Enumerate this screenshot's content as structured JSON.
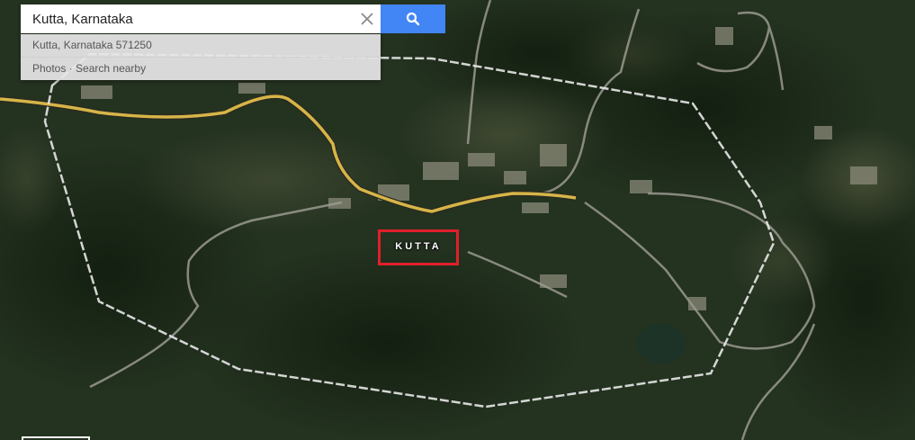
{
  "search": {
    "value": "Kutta, Karnataka",
    "clear_icon": "close-icon",
    "button_icon": "search-icon",
    "button_color": "#4285f4"
  },
  "suggestions": {
    "address": "Kutta, Karnataka 571250",
    "actions": [
      "Photos",
      "Search nearby"
    ],
    "separator": "·"
  },
  "place_label": {
    "text": "KUTTA",
    "highlight_color": "#e0202a"
  },
  "map": {
    "view": "satellite",
    "boundary_style": "dashed-white",
    "major_road_color": "#d6b548"
  }
}
